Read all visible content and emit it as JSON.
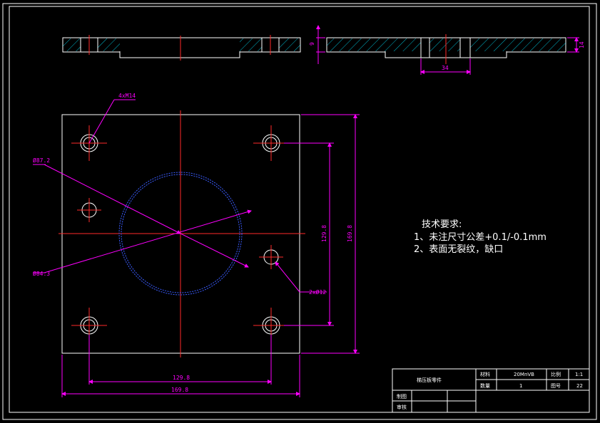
{
  "drawing": {
    "thickness_dim": "9",
    "step_width_dim": "34",
    "step_height_dim": "14",
    "hole_callout": "4xM14",
    "diameter_outer": "Ø87.2",
    "diameter_inner": "Ø84.3",
    "small_hole_callout": "2xØ12",
    "vertical_inner_dim": "129.8",
    "vertical_outer_dim": "169.8",
    "horizontal_inner_dim": "129.8",
    "horizontal_outer_dim": "169.8"
  },
  "technical_requirements": {
    "heading": "技术要求:",
    "items": [
      "1、未注尺寸公差+0.1/-0.1mm",
      "2、表面无裂纹，缺口"
    ]
  },
  "title_block": {
    "part_name": "梯压板零件",
    "material_label": "材料",
    "material_value": "20MnVB",
    "scale_label": "比例",
    "scale_value": "1:1",
    "quantity_label": "数量",
    "quantity_value": "1",
    "sheet_label": "图号",
    "sheet_value": "22",
    "drawn_label": "制图",
    "checked_label": "审核"
  },
  "colors": {
    "outline": "#ffffff",
    "center_line": "#ff2a2a",
    "dimension": "#ff00ff",
    "hatch": "#00e5ff",
    "hidden_circle": "#3a5cff"
  }
}
